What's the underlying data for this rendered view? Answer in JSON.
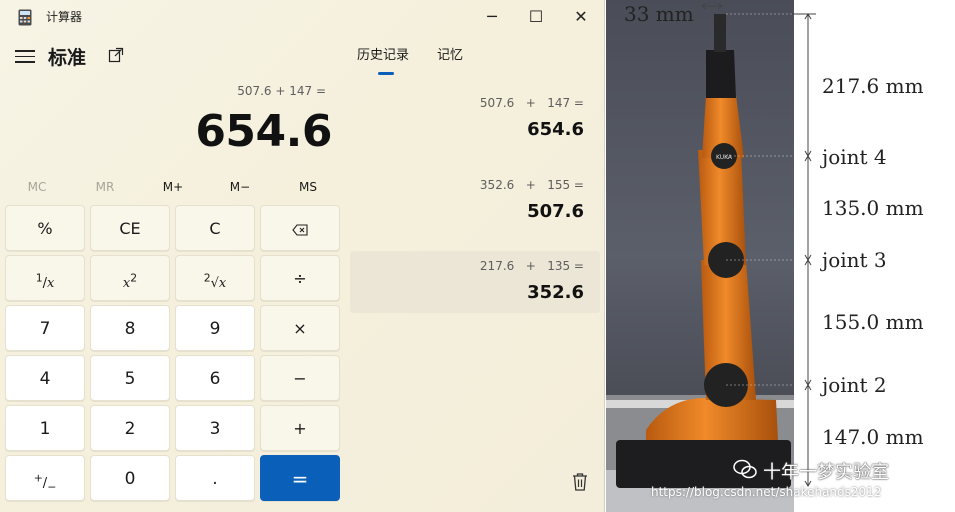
{
  "window": {
    "title": "计算器",
    "minimize_glyph": "─",
    "maximize_glyph": "☐",
    "close_glyph": "✕"
  },
  "header": {
    "mode": "标准",
    "menu_icon": "hamburger-icon",
    "keep_on_top_icon": "keep-on-top-icon"
  },
  "display": {
    "expression": "507.6 + 147 =",
    "value": "654.6"
  },
  "memory": [
    "MC",
    "MR",
    "M+",
    "M−",
    "MS"
  ],
  "keys": {
    "percent": "%",
    "ce": "CE",
    "c": "C",
    "backspace": "⌫",
    "divide": "÷",
    "seven": "7",
    "eight": "8",
    "nine": "9",
    "multiply": "×",
    "four": "4",
    "five": "5",
    "six": "6",
    "minus": "−",
    "one": "1",
    "two": "2",
    "three": "3",
    "plus": "+",
    "negate": "⁺⁄₋",
    "zero": "0",
    "decimal": ".",
    "equals": "="
  },
  "tabs": {
    "history": "历史记录",
    "memory": "记忆"
  },
  "history": [
    {
      "expression": "507.6   +   147 =",
      "result": "654.6"
    },
    {
      "expression": "352.6   +   155 =",
      "result": "507.6"
    },
    {
      "expression": "217.6   +   135 =",
      "result": "352.6"
    }
  ],
  "figure": {
    "top_width": "33 mm",
    "seg1": "217.6 mm",
    "joint4": "joint 4",
    "seg2": "135.0 mm",
    "joint3": "joint 3",
    "seg3": "155.0 mm",
    "joint2": "joint 2",
    "seg4": "147.0 mm",
    "watermark": "十年一梦实验室",
    "watermark_url": "https://blog.csdn.net/shakehands2012",
    "brand": "KUKA"
  },
  "colors": {
    "accent": "#0a5fb8",
    "robot_orange": "#e07a1a",
    "calc_bg": "#f5f0dc"
  }
}
